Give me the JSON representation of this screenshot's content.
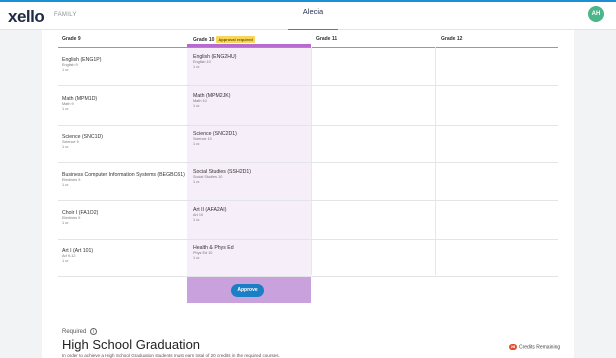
{
  "app": {
    "logo": "xello",
    "section": "FAMILY",
    "student": "Alecia",
    "avatar_initials": "AH"
  },
  "grades": {
    "g9": "Grade 9",
    "g10": "Grade 10",
    "g10_badge": "Approval required",
    "g11": "Grade 11",
    "g12": "Grade 12"
  },
  "grade9": [
    {
      "name": "English (ENG1P)",
      "sub": "English 9",
      "credit": "1 cr."
    },
    {
      "name": "Math (MPM1D)",
      "sub": "Math 9",
      "credit": "1 cr."
    },
    {
      "name": "Science (SNC1D)",
      "sub": "Science 9",
      "credit": "1 cr."
    },
    {
      "name": "Business Computer Information Systems (BEGBC61)",
      "sub": "Electives 9",
      "credit": "1 cr."
    },
    {
      "name": "Choir I (FA1O2)",
      "sub": "Electives 9",
      "credit": "1 cr."
    },
    {
      "name": "Art I (Art 101)",
      "sub": "Art 9-12",
      "credit": "1 cr."
    }
  ],
  "grade10": [
    {
      "name": "English (ENG2HU)",
      "sub": "English 10",
      "credit": "1 cr."
    },
    {
      "name": "Math (MPM2JK)",
      "sub": "Math 10",
      "credit": "1 cr."
    },
    {
      "name": "Science (SNC2D1)",
      "sub": "Science 10",
      "credit": "1 cr."
    },
    {
      "name": "Social Studies (SSH2D1)",
      "sub": "Social Studies 10",
      "credit": "1 cr."
    },
    {
      "name": "Art II (AFA2AI)",
      "sub": "Art 10",
      "credit": "1 cr."
    },
    {
      "name": "Health & Phys Ed",
      "sub": "Phys Ed 10",
      "credit": "1 cr."
    }
  ],
  "approve_label": "Approve",
  "graduation": {
    "required_label": "Required",
    "title": "High School Graduation",
    "description": "In order to achieve a High School Graduation students must earn total of 20 credits in the required courses.",
    "credits_count": "28",
    "credits_label": "Credits Remaining"
  }
}
